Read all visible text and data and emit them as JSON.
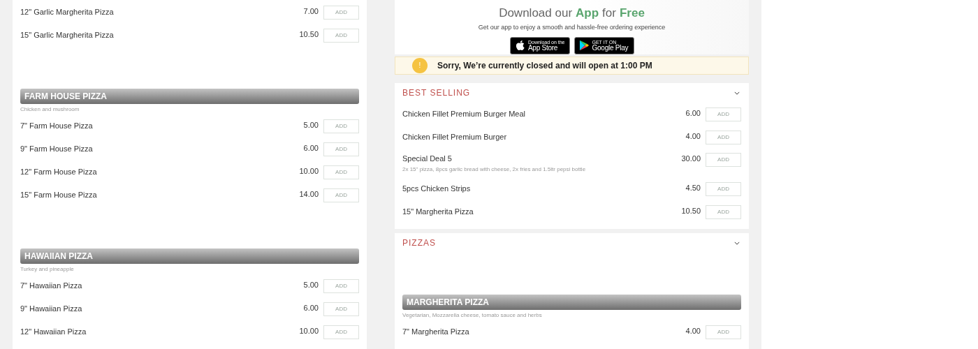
{
  "left_menu": {
    "groups": [
      {
        "items": [
          {
            "name": "12\" Garlic Margherita Pizza",
            "price": "7.00",
            "button": "ADD",
            "disabled": true
          },
          {
            "name": "15\" Garlic Margherita Pizza",
            "price": "10.50",
            "button": "ADD",
            "disabled": true
          }
        ]
      },
      {
        "title": "FARM HOUSE PIZZA",
        "description": "Chicken and mushroom",
        "items": [
          {
            "name": "7\" Farm House Pizza",
            "price": "5.00",
            "button": "ADD",
            "disabled": true
          },
          {
            "name": "9\" Farm House Pizza",
            "price": "6.00",
            "button": "ADD",
            "disabled": true
          },
          {
            "name": "12\" Farm House Pizza",
            "price": "10.00",
            "button": "ADD",
            "disabled": true
          },
          {
            "name": "15\" Farm House Pizza",
            "price": "14.00",
            "button": "ADD",
            "disabled": true
          }
        ]
      },
      {
        "title": "HAWAIIAN PIZZA",
        "description": "Turkey and pineapple",
        "items": [
          {
            "name": "7\" Hawaiian Pizza",
            "price": "5.00",
            "button": "ADD",
            "disabled": true
          },
          {
            "name": "9\" Hawaiian Pizza",
            "price": "6.00",
            "button": "ADD",
            "disabled": true
          },
          {
            "name": "12\" Hawaiian Pizza",
            "price": "10.00",
            "button": "ADD",
            "disabled": true
          }
        ]
      }
    ]
  },
  "app_promo": {
    "title": [
      {
        "text": "Download our",
        "highlight": false
      },
      {
        "text": "App",
        "highlight": true
      },
      {
        "text": "for",
        "highlight": false
      },
      {
        "text": "Free",
        "highlight": true
      }
    ],
    "subtitle": "Get our app to enjoy a smooth and hassle-free ordering experience",
    "badges": [
      {
        "kind": "apple",
        "small": "Download on the",
        "big": "App Store"
      },
      {
        "kind": "google",
        "small": "GET IT ON",
        "big": "Google Play"
      }
    ]
  },
  "notice": {
    "icon": "!",
    "text": "Sorry, We’re currently closed and will open at 1:00 PM"
  },
  "categories": [
    {
      "title": "BEST SELLING",
      "items": [
        {
          "name": "Chicken Fillet Premium Burger Meal",
          "price": "6.00",
          "button": "ADD",
          "disabled": true
        },
        {
          "name": "Chicken Fillet Premium Burger",
          "price": "4.00",
          "button": "ADD",
          "disabled": true
        },
        {
          "name": "Special Deal 5",
          "description": "2x 15\" pizza, 8pcs garlic bread with cheese, 2x fries and 1.5ltr pepsi bottle",
          "price": "30.00",
          "button": "ADD",
          "disabled": true
        },
        {
          "name": "5pcs Chicken Strips",
          "price": "4.50",
          "button": "ADD",
          "disabled": true
        },
        {
          "name": "15\" Margherita Pizza",
          "price": "10.50",
          "button": "ADD",
          "disabled": true
        }
      ]
    },
    {
      "title": "PIZZAS",
      "groups": [
        {
          "title": "MARGHERITA PIZZA",
          "description": "Vegetarian, Mozzarella cheese, tomato sauce and herbs",
          "items": [
            {
              "name": "7\" Margherita Pizza",
              "price": "4.00",
              "button": "ADD",
              "disabled": true
            }
          ]
        }
      ]
    }
  ]
}
